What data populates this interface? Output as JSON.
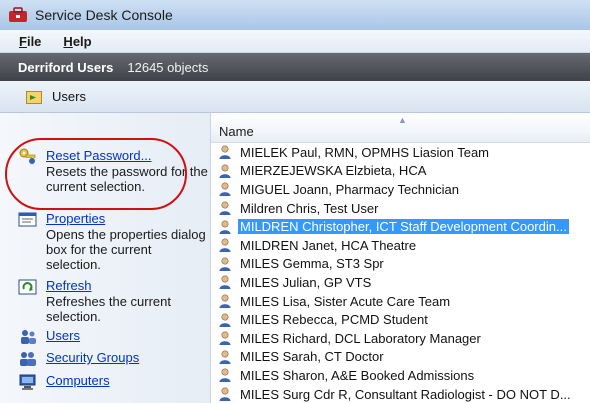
{
  "window": {
    "title": "Service Desk Console"
  },
  "menu": {
    "items": [
      "File",
      "Help"
    ]
  },
  "header": {
    "container_name": "Derriford Users",
    "object_count": "12645 objects"
  },
  "location": {
    "label": "Users"
  },
  "tasks": [
    {
      "label": "Reset Password...",
      "description": "Resets the password for the current selection.",
      "icon": "key-user-icon"
    },
    {
      "label": "Properties",
      "description": "Opens the properties dialog box for the current selection.",
      "icon": "properties-icon"
    },
    {
      "label": "Refresh",
      "description": "Refreshes the current selection.",
      "icon": "refresh-icon"
    },
    {
      "label": "Users",
      "icon": "users-icon"
    },
    {
      "label": "Security Groups",
      "icon": "security-groups-icon"
    },
    {
      "label": "Computers",
      "icon": "computers-icon"
    }
  ],
  "list": {
    "column_header": "Name",
    "rows": [
      "MIELEK Paul, RMN, OPMHS Liasion Team",
      "MIERZEJEWSKA Elzbieta, HCA",
      "MIGUEL Joann, Pharmacy Technician",
      "Mildren Chris, Test User",
      "MILDREN Christopher, ICT Staff Development Coordin...",
      "MILDREN Janet, HCA Theatre",
      "MILES Gemma, ST3 Spr",
      "MILES Julian, GP VTS",
      "MILES Lisa, Sister Acute Care Team",
      "MILES Rebecca, PCMD Student",
      "MILES Richard, DCL Laboratory Manager",
      "MILES Sarah, CT Doctor",
      "MILES Sharon, A&E Booked Admissions",
      "MILES Surg Cdr R, Consultant Radiologist - DO NOT D..."
    ],
    "selected_index": 4
  },
  "colors": {
    "selection": "#3399ff",
    "link": "#0033cc",
    "highlight_ring": "#d01010"
  }
}
